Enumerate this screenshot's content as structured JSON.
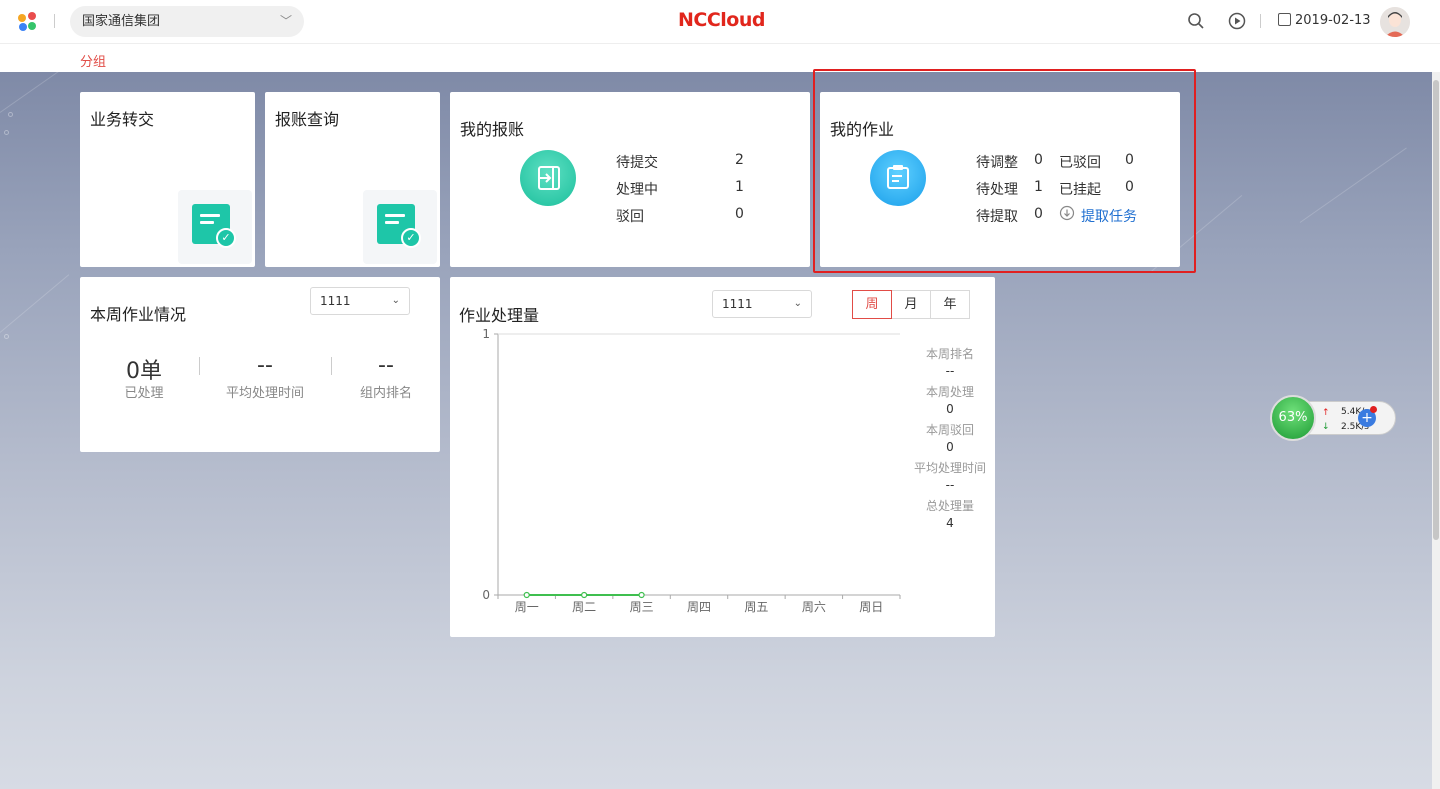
{
  "header": {
    "org_name": "国家通信集团",
    "logo_text": "NCCloud",
    "date": "2019-02-13",
    "icons": [
      "apps-icon",
      "search-icon",
      "play-icon",
      "calendar-icon"
    ]
  },
  "subnav": {
    "tab_label": "分组"
  },
  "cards": {
    "transfer": {
      "title": "业务转交"
    },
    "query": {
      "title": "报账查询"
    },
    "my_claims": {
      "title": "我的报账",
      "stats": [
        {
          "label": "待提交",
          "value": "2"
        },
        {
          "label": "处理中",
          "value": "1"
        },
        {
          "label": "驳回",
          "value": "0"
        }
      ]
    },
    "my_jobs": {
      "title": "我的作业",
      "stats": [
        {
          "label": "待调整",
          "value": "0"
        },
        {
          "label": "已驳回",
          "value": "0"
        },
        {
          "label": "待处理",
          "value": "1"
        },
        {
          "label": "已挂起",
          "value": "0"
        },
        {
          "label": "待提取",
          "value": "0"
        }
      ],
      "fetch_link": "提取任务"
    },
    "weekly": {
      "title": "本周作业情况",
      "select_value": "1111",
      "metrics": [
        {
          "value": "0单",
          "label": "已处理"
        },
        {
          "value": "--",
          "label": "平均处理时间"
        },
        {
          "value": "--",
          "label": "组内排名"
        }
      ]
    },
    "volume": {
      "title": "作业处理量",
      "select_value": "1111",
      "periods": [
        "周",
        "月",
        "年"
      ],
      "active_period": "周",
      "side_stats": [
        {
          "label": "本周排名",
          "value": "--"
        },
        {
          "label": "本周处理",
          "value": "0"
        },
        {
          "label": "本周驳回",
          "value": "0"
        },
        {
          "label": "平均处理时间",
          "value": "--"
        },
        {
          "label": "总处理量",
          "value": "4"
        }
      ]
    }
  },
  "chart_data": {
    "type": "line",
    "categories": [
      "周一",
      "周二",
      "周三",
      "周四",
      "周五",
      "周六",
      "周日"
    ],
    "series": [
      {
        "values": [
          0,
          0,
          0
        ]
      }
    ],
    "ylim": [
      0,
      1
    ],
    "yticks": [
      "0",
      "1"
    ],
    "color": "#3fbf4f"
  },
  "net_widget": {
    "percent": "63%",
    "up": "5.4K/s",
    "down": "2.5K/s"
  }
}
